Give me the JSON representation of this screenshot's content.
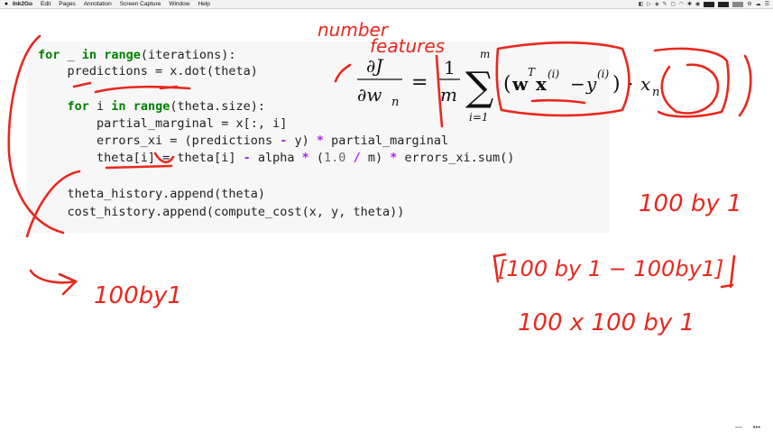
{
  "menubar": {
    "app_name": "Ink2Go",
    "items": [
      "Edit",
      "Pages",
      "Annotation",
      "Screen Capture",
      "Window",
      "Help"
    ]
  },
  "code_lines": [
    [
      [
        "kw",
        "for"
      ],
      [
        "t",
        " _ "
      ],
      [
        "kw",
        "in"
      ],
      [
        "t",
        " "
      ],
      [
        "kw",
        "range"
      ],
      [
        "t",
        "(iterations):"
      ]
    ],
    [
      [
        "t",
        "    predictions = x.dot(theta)"
      ]
    ],
    [
      [
        "t",
        ""
      ]
    ],
    [
      [
        "t",
        "    "
      ],
      [
        "kw",
        "for"
      ],
      [
        "t",
        " i "
      ],
      [
        "kw",
        "in"
      ],
      [
        "t",
        " "
      ],
      [
        "kw",
        "range"
      ],
      [
        "t",
        "(theta.size):"
      ]
    ],
    [
      [
        "t",
        "        partial_marginal = x[:, i]"
      ]
    ],
    [
      [
        "t",
        "        errors_xi = (predictions "
      ],
      [
        "op",
        "-"
      ],
      [
        "t",
        " y) "
      ],
      [
        "op",
        "*"
      ],
      [
        "t",
        " partial_marginal"
      ]
    ],
    [
      [
        "t",
        "        theta[i] = theta[i] "
      ],
      [
        "op",
        "-"
      ],
      [
        "t",
        " alpha "
      ],
      [
        "op",
        "*"
      ],
      [
        "t",
        " ("
      ],
      [
        "num",
        "1.0"
      ],
      [
        "t",
        " "
      ],
      [
        "op",
        "/"
      ],
      [
        "t",
        " m) "
      ],
      [
        "op",
        "*"
      ],
      [
        "t",
        " errors_xi.sum()"
      ]
    ],
    [
      [
        "t",
        ""
      ]
    ],
    [
      [
        "t",
        "    theta_history.append(theta)"
      ]
    ],
    [
      [
        "t",
        "    cost_history.append(compute_cost(x, y, theta))"
      ]
    ]
  ],
  "formula": {
    "lhs_num": "∂J",
    "lhs_den": "∂w",
    "lhs_sub": "n",
    "eq": "=",
    "frac_num": "1",
    "frac_den": "m",
    "sum": "∑",
    "sum_top": "m",
    "sum_bot": "i=1",
    "open": "(",
    "w": "w",
    "T": "T",
    "x": "x",
    "sup_i": "(i)",
    "minus": "−",
    "y": "y",
    "sup_i2": "(i)",
    "close": ")",
    "dot": "·",
    "xn": "x",
    "xn_sub": "n"
  },
  "annotations": {
    "number": "number",
    "features": "features",
    "hundred_by_one_right": "100 by 1",
    "bracket_expr": "[100 by 1 − 100by1]",
    "product": "100 x 100 by 1",
    "hundred_by_one_left": "100by1"
  },
  "ink_color": "#e8281e",
  "corner": {
    "a": "—",
    "b": "•••"
  }
}
